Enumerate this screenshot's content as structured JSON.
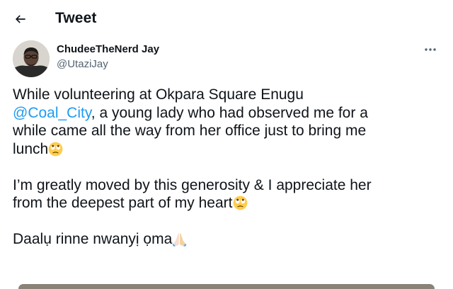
{
  "header": {
    "title": "Tweet",
    "back_icon": "arrow-left-icon"
  },
  "author": {
    "name": "ChudeeTheNerd Jay",
    "handle": "@UtaziJay",
    "avatar_icon": "profile-photo"
  },
  "more_icon": "more-horizontal-icon",
  "tweet": {
    "line1": "While volunteering at Okpara Square Enugu",
    "mention": "@Coal_City",
    "line2_rest": ", a young lady who had observed me for a",
    "line3": "while came all the way from her office just to bring me",
    "line4": "lunch",
    "para2_line1": "I’m greatly moved by this generosity & I appreciate her",
    "para2_line2": "from the deepest part of my heart",
    "para3": "Daalụ rinne nwanyị ọma",
    "emoji_1": "face-with-rolling-eyes-icon",
    "emoji_2": "face-with-rolling-eyes-icon",
    "emoji_3": "folded-hands-icon"
  },
  "colors": {
    "text": "#0f1419",
    "secondary": "#536471",
    "link": "#1d9bf0"
  }
}
